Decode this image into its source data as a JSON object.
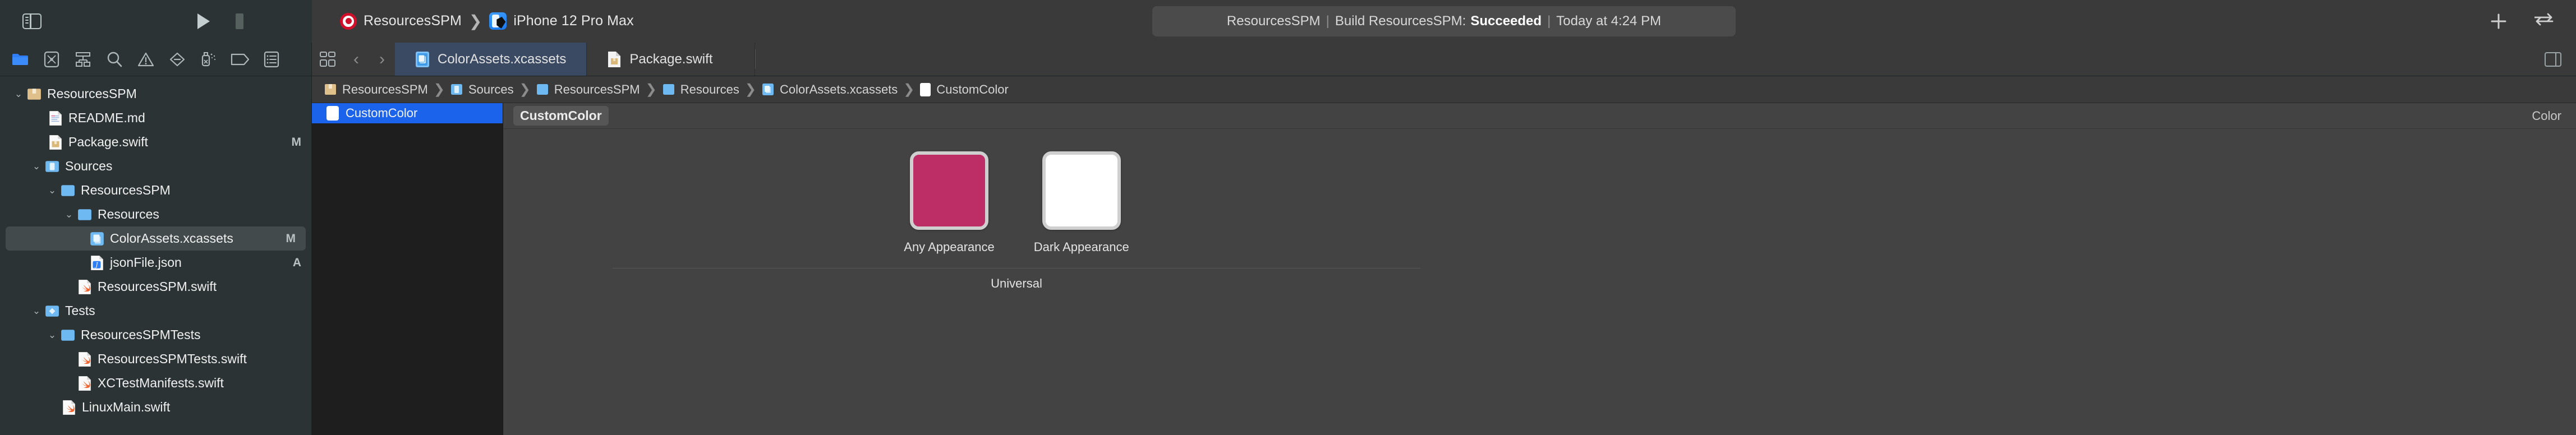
{
  "toolbar": {
    "sidebar_toggle_name": "Hide/Show Navigator",
    "run_label": "Run",
    "stop_label": "Stop",
    "scheme_name": "ResourcesSPM",
    "destination_name": "iPhone 12 Pro Max",
    "scheme_separator": "❯",
    "add_label": "+",
    "swap_label": "Swap"
  },
  "status": {
    "project": "ResourcesSPM",
    "action": "Build ResourcesSPM:",
    "result": "Succeeded",
    "time": "Today at 4:24 PM",
    "separator": "|"
  },
  "navigator_toolbar": {
    "icons": [
      {
        "name": "project-navigator-icon",
        "label": "Project"
      },
      {
        "name": "source-control-navigator-icon",
        "label": "Source Control"
      },
      {
        "name": "symbol-navigator-icon",
        "label": "Symbols"
      },
      {
        "name": "find-navigator-icon",
        "label": "Find"
      },
      {
        "name": "issue-navigator-icon",
        "label": "Issues"
      },
      {
        "name": "test-navigator-icon",
        "label": "Tests"
      },
      {
        "name": "debug-navigator-icon",
        "label": "Debug"
      },
      {
        "name": "breakpoint-navigator-icon",
        "label": "Breakpoints"
      },
      {
        "name": "report-navigator-icon",
        "label": "Reports"
      }
    ]
  },
  "tabs": {
    "grid_button": "Editor Options",
    "back": "‹",
    "forward": "›",
    "items": [
      {
        "label": "ColorAssets.xcassets",
        "icon": "xcassets-icon",
        "active": true
      },
      {
        "label": "Package.swift",
        "icon": "package-file-icon",
        "active": false
      }
    ]
  },
  "breadcrumb": {
    "items": [
      {
        "label": "ResourcesSPM",
        "icon": "package-icon"
      },
      {
        "label": "Sources",
        "icon": "folder-sources-icon"
      },
      {
        "label": "ResourcesSPM",
        "icon": "folder-icon"
      },
      {
        "label": "Resources",
        "icon": "folder-icon"
      },
      {
        "label": "ColorAssets.xcassets",
        "icon": "xcassets-icon"
      },
      {
        "label": "CustomColor",
        "icon": "color-swatch-icon"
      }
    ],
    "separator": "❯"
  },
  "file_tree": [
    {
      "label": "ResourcesSPM",
      "icon": "package-icon",
      "indent": 0,
      "twisty": "⌄",
      "badge": "",
      "selected": false
    },
    {
      "label": "README.md",
      "icon": "readme-icon",
      "indent": 1,
      "twisty": "",
      "badge": "",
      "selected": false
    },
    {
      "label": "Package.swift",
      "icon": "package-file-icon",
      "indent": 1,
      "twisty": "",
      "badge": "M",
      "selected": false
    },
    {
      "label": "Sources",
      "icon": "folder-src-icon",
      "indent": 1,
      "twisty": "⌄",
      "badge": "",
      "selected": false
    },
    {
      "label": "ResourcesSPM",
      "icon": "folder-icon",
      "indent": 2,
      "twisty": "⌄",
      "badge": "",
      "selected": false
    },
    {
      "label": "Resources",
      "icon": "folder-icon",
      "indent": 3,
      "twisty": "⌄",
      "badge": "",
      "selected": false
    },
    {
      "label": "ColorAssets.xcassets",
      "icon": "xcassets-icon",
      "indent": 4,
      "twisty": "",
      "badge": "M",
      "selected": true
    },
    {
      "label": "jsonFile.json",
      "icon": "json-file-icon",
      "indent": 4,
      "twisty": "",
      "badge": "A",
      "selected": false
    },
    {
      "label": "ResourcesSPM.swift",
      "icon": "swift-file-icon",
      "indent": 3,
      "twisty": "",
      "badge": "",
      "selected": false
    },
    {
      "label": "Tests",
      "icon": "folder-tests-icon",
      "indent": 1,
      "twisty": "⌄",
      "badge": "",
      "selected": false
    },
    {
      "label": "ResourcesSPMTests",
      "icon": "folder-icon",
      "indent": 2,
      "twisty": "⌄",
      "badge": "",
      "selected": false
    },
    {
      "label": "ResourcesSPMTests.swift",
      "icon": "swift-file-icon",
      "indent": 3,
      "twisty": "",
      "badge": "",
      "selected": false
    },
    {
      "label": "XCTestManifests.swift",
      "icon": "swift-file-icon",
      "indent": 3,
      "twisty": "",
      "badge": "",
      "selected": false
    },
    {
      "label": "LinuxMain.swift",
      "icon": "swift-file-icon",
      "indent": 2,
      "twisty": "",
      "badge": "",
      "selected": false
    }
  ],
  "asset_list": [
    {
      "label": "CustomColor",
      "selected": true,
      "swatch": "#ffffff"
    }
  ],
  "editor": {
    "title": "CustomColor",
    "type_label": "Color",
    "universal_label": "Universal",
    "appearances": [
      {
        "label": "Any Appearance",
        "color": "#bd2d66"
      },
      {
        "label": "Dark Appearance",
        "color": "#ffffff"
      }
    ]
  },
  "colors": {
    "window_chrome": "#3a3a3a",
    "navigator_bg": "#2b3335",
    "asset_list_bg": "#1e1e1e",
    "editor_bg": "#434343",
    "selection_blue": "#1c63eb",
    "tab_active": "#3b4a63",
    "accent_custom_color": "#bd2d66"
  }
}
